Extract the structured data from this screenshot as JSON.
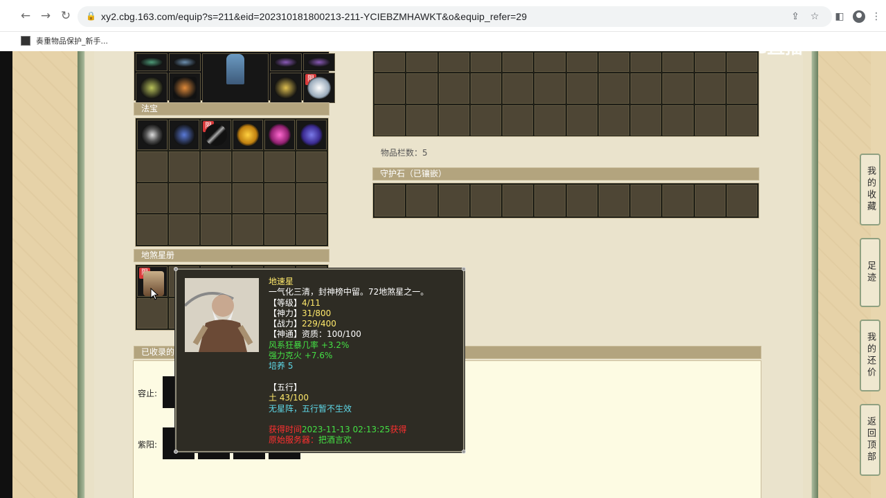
{
  "browser": {
    "url": "xy2.cbg.163.com/equip?s=211&eid=202310181800213-211-YCIEBZMHAWKT&o&equip_refer=29",
    "bookmark": "奏重物品保护_新手..."
  },
  "watermark": "CC直播",
  "sections": {
    "fabao_title": "法宝",
    "disha_title": "地煞星册",
    "guard_title": "守护石（已镶嵌）",
    "collected_title": "已收录的",
    "item_count_label": "物品栏数：5"
  },
  "lower_labels": [
    "容止:",
    "紫阳:"
  ],
  "badge_limit": "限",
  "side_buttons": [
    {
      "label": "我的收藏"
    },
    {
      "label": "足迹"
    },
    {
      "label": "我的还价"
    },
    {
      "label": "返回顶部"
    }
  ],
  "tooltip": {
    "name": "地速星",
    "desc": "一气化三清，封神榜中留。72地煞星之一。",
    "level_key": "【等级】",
    "level_val": "4/11",
    "power_key": "【神力】",
    "power_val": "31/800",
    "battle_key": "【战力】",
    "battle_val": "229/400",
    "shentong_key": "【神通】",
    "shentong_val": "资质：100/100",
    "attr1": "风系狂暴几率 +3.2%",
    "attr2": "强力克火 +7.6%",
    "train": "培养 5",
    "wuxing_key": "【五行】",
    "wuxing_val": "土 43/100",
    "wuxing_note": "无星阵，五行暂不生效",
    "time_prefix": "获得时间",
    "time_val": "2023-11-13 02:13:25",
    "time_suffix": "获得",
    "server_prefix": "原始服务器：",
    "server_val": "把酒言欢"
  },
  "colors": {
    "panel_header": "#b3a47e",
    "cell": "#4e4635",
    "tooltip_bg": "#2e2c24",
    "tt_yellow": "#ffe96b",
    "tt_green": "#44e044",
    "tt_cyan": "#5ed8e8",
    "tt_red": "#ff3030"
  }
}
